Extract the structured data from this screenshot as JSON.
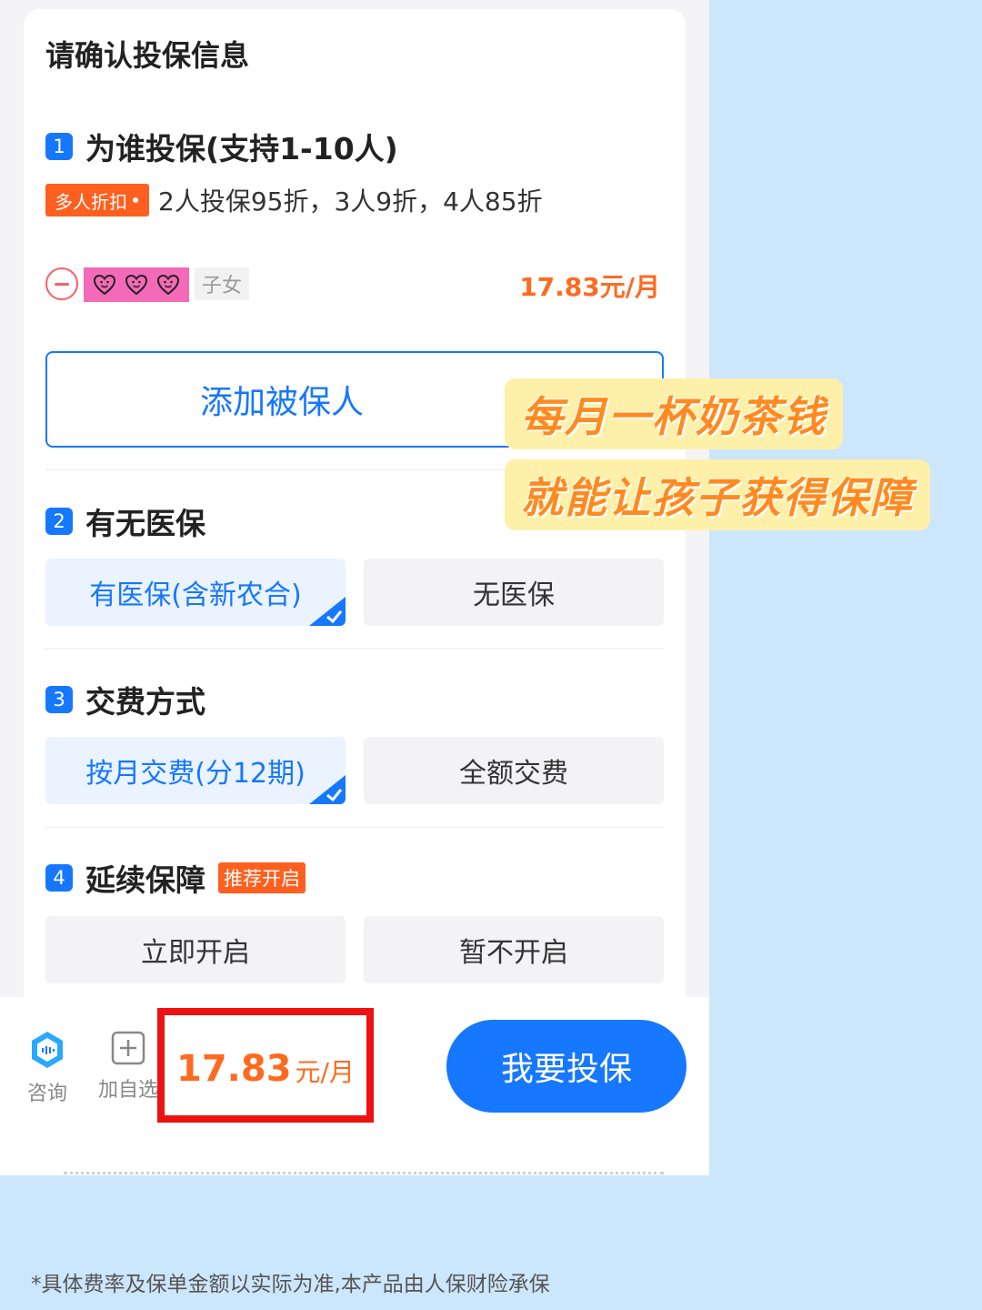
{
  "card": {
    "title": "请确认投保信息"
  },
  "sections": [
    {
      "num": "1",
      "title": "为谁投保(支持1-10人)"
    },
    {
      "num": "2",
      "title": "有无医保"
    },
    {
      "num": "3",
      "title": "交费方式"
    },
    {
      "num": "4",
      "title": "延续保障",
      "tag": "推荐开启"
    }
  ],
  "discount": {
    "badge": "多人折扣",
    "text": "2人投保95折，3人9折，4人85折"
  },
  "insured": {
    "relation": "子女",
    "price": "17.83元/月",
    "mask_icons": [
      "heart-face-icon",
      "heart-face-icon",
      "heart-face-icon"
    ]
  },
  "add_button": "添加被保人",
  "medical": {
    "options": [
      "有医保(含新农合)",
      "无医保"
    ],
    "selected": 0
  },
  "payment": {
    "options": [
      "按月交费(分12期)",
      "全额交费"
    ],
    "selected": 0
  },
  "renewal": {
    "options": [
      "立即开启",
      "暂不开启"
    ]
  },
  "bottom_bar": {
    "consult_label": "咨询",
    "favorite_label": "加自选",
    "price": "17.83",
    "price_unit": "元/月",
    "buy_label": "我要投保"
  },
  "banners": [
    "每月一杯奶茶钱",
    "就能让孩子获得保障"
  ],
  "footnote": "*具体费率及保单金额以实际为准,本产品由人保财险承保",
  "colors": {
    "primary": "#1677ff",
    "accent": "#ff6a1f",
    "highlight_box": "#ee1111",
    "banner_bg": "#fef0a8"
  }
}
